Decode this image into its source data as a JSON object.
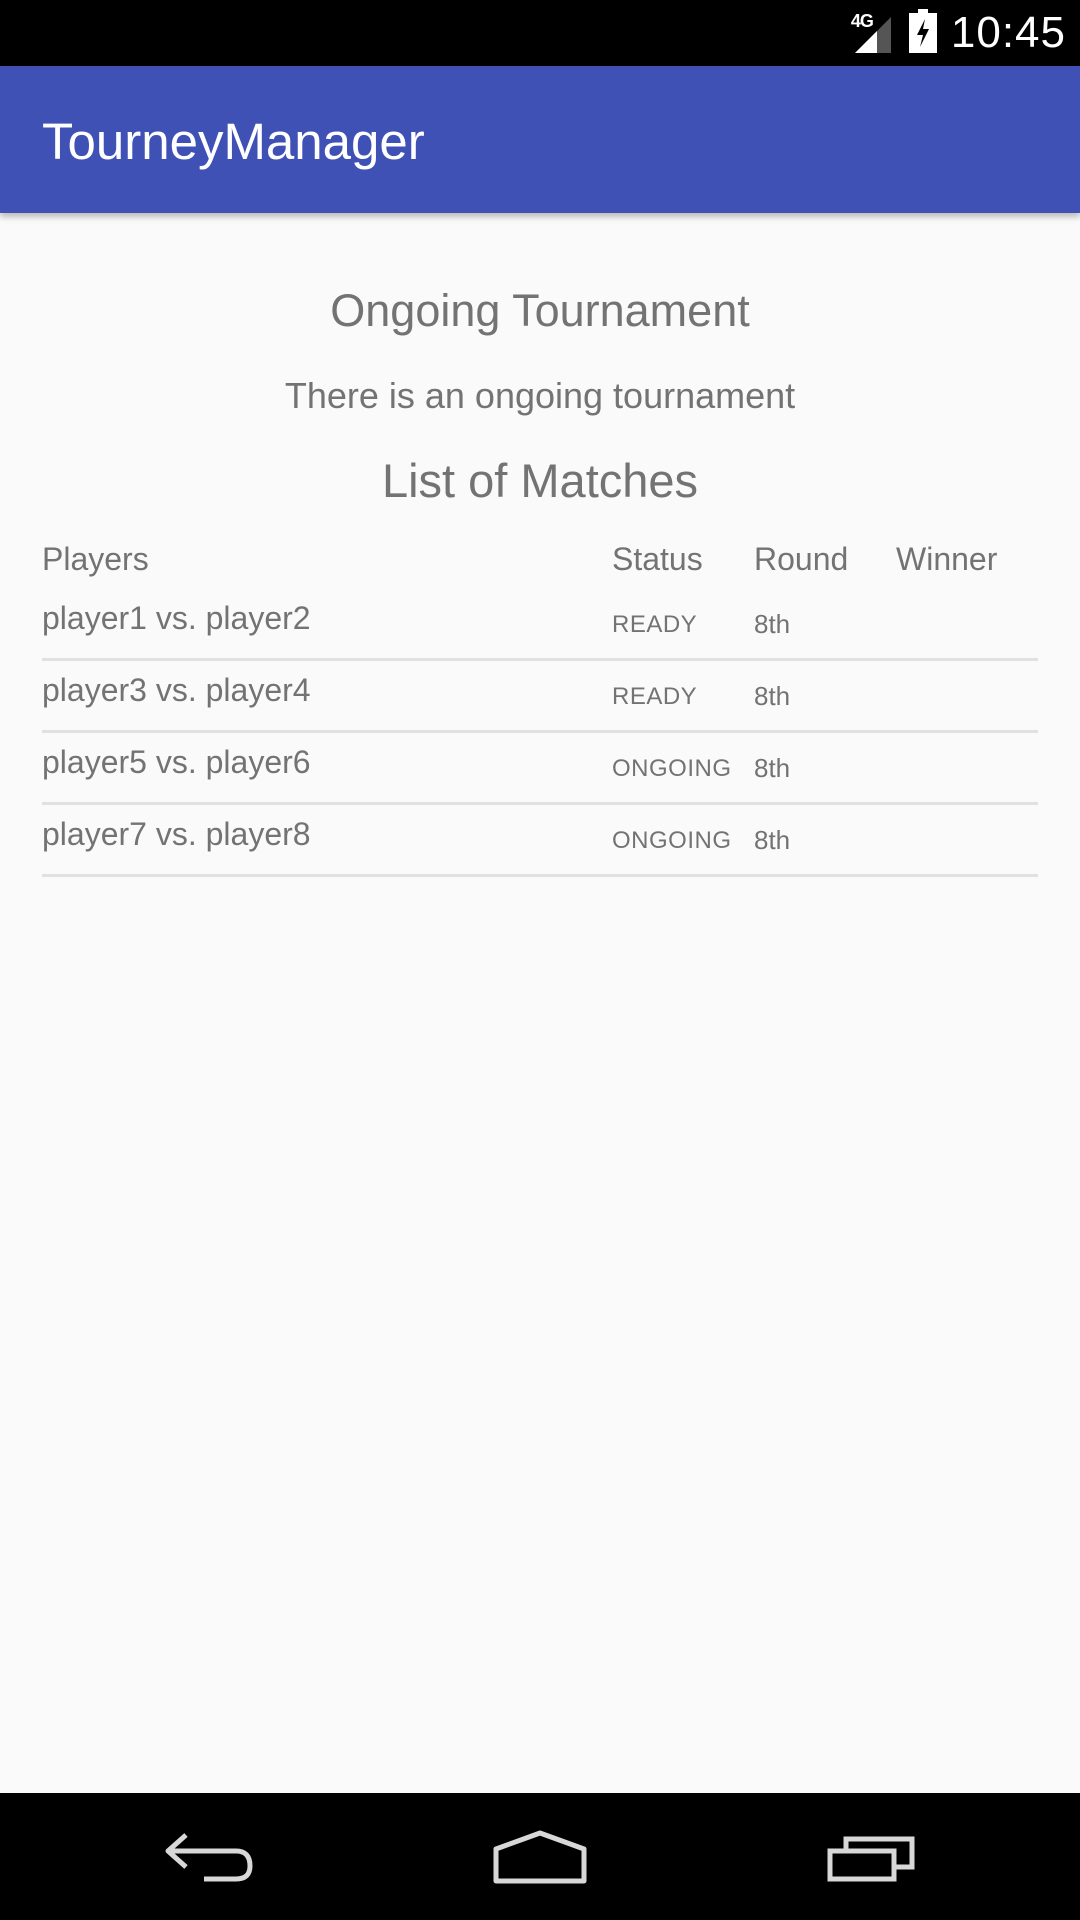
{
  "status_bar": {
    "network_label": "4G",
    "time": "10:45"
  },
  "app_bar": {
    "title": "TourneyManager"
  },
  "main": {
    "heading": "Ongoing Tournament",
    "subtitle": "There is an ongoing tournament",
    "list_heading": "List of Matches",
    "columns": [
      "Players",
      "Status",
      "Round",
      "Winner"
    ],
    "matches": [
      {
        "players": "player1 vs. player2",
        "status": "READY",
        "round": "8th",
        "winner": ""
      },
      {
        "players": "player3 vs. player4",
        "status": "READY",
        "round": "8th",
        "winner": ""
      },
      {
        "players": "player5 vs. player6",
        "status": "ONGOING",
        "round": "8th",
        "winner": ""
      },
      {
        "players": "player7 vs. player8",
        "status": "ONGOING",
        "round": "8th",
        "winner": ""
      }
    ]
  },
  "icons": {
    "signal": "signal-icon",
    "battery": "battery-icon",
    "back": "back-icon",
    "home": "home-icon",
    "recent": "recent-apps-icon"
  },
  "colors": {
    "app_bar": "#3f51b5",
    "text": "#737373",
    "background": "#fafafa"
  }
}
